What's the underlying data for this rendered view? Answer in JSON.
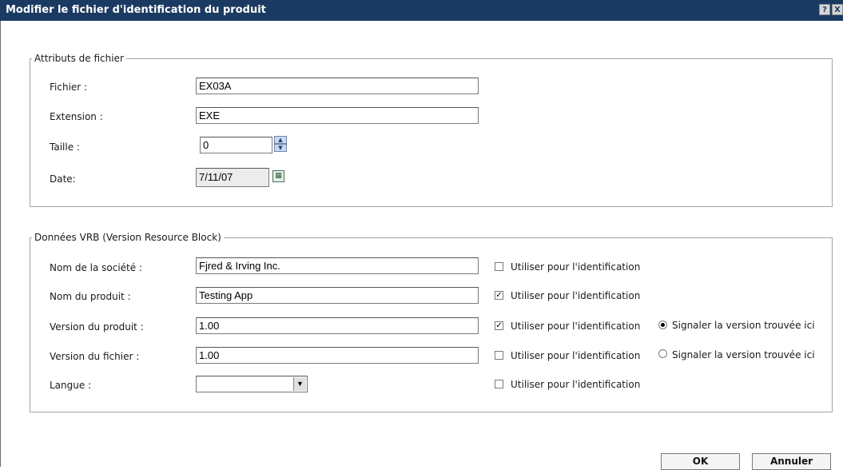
{
  "dialog": {
    "title": "Modifier le fichier d'identification du produit",
    "help_icon": "?",
    "close_icon": "X"
  },
  "file_attributes": {
    "legend": "Attributs de fichier",
    "file_label": "Fichier :",
    "file_value": "EX03A",
    "extension_label": "Extension :",
    "extension_value": "EXE",
    "size_label": "Taille :",
    "size_value": "0",
    "date_label": "Date:",
    "date_value": "7/11/07"
  },
  "vrb": {
    "legend": "Données VRB (Version Resource Block)",
    "use_label": "Utiliser pour l'identification",
    "report_label": "Signaler la version trouvée ici",
    "company_label": "Nom de la société :",
    "company_value": "Fjred & Irving Inc.",
    "company_checked": false,
    "product_label": "Nom du produit :",
    "product_value": "Testing App",
    "product_checked": true,
    "product_version_label": "Version du produit :",
    "product_version_value": "1.00",
    "product_version_checked": true,
    "product_version_report_selected": true,
    "file_version_label": "Version du fichier :",
    "file_version_value": "1.00",
    "file_version_checked": false,
    "file_version_report_selected": false,
    "language_label": "Langue :",
    "language_value": "",
    "language_checked": false
  },
  "buttons": {
    "ok": "OK",
    "cancel": "Annuler"
  }
}
